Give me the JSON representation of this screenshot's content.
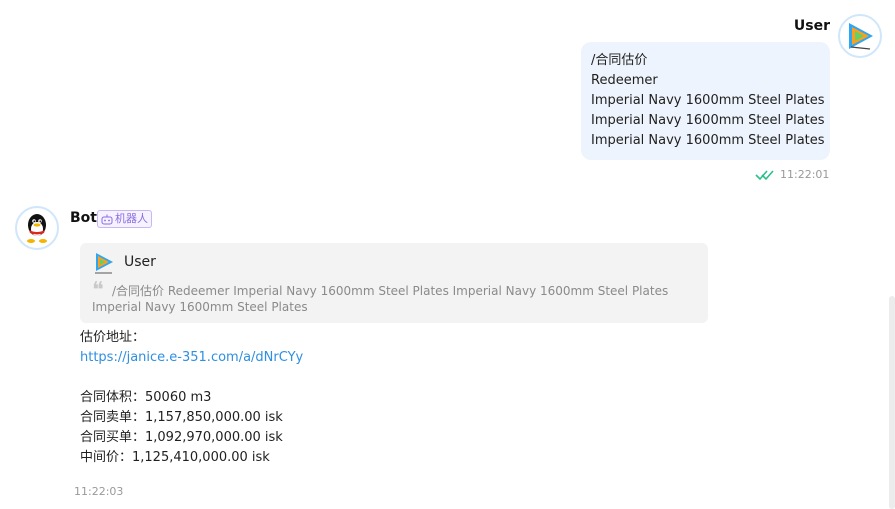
{
  "user_message": {
    "sender": "User",
    "lines": [
      "/合同估价",
      "Redeemer",
      "Imperial Navy 1600mm Steel Plates",
      "Imperial Navy 1600mm Steel Plates",
      "Imperial Navy 1600mm Steel Plates"
    ],
    "time": "11:22:01",
    "read_icon": "double-check-icon",
    "avatar_icon": "tencent-video-logo"
  },
  "bot_message": {
    "sender": "Bot",
    "tag": "机器人",
    "tag_icon": "robot-icon",
    "avatar_icon": "qq-penguin-logo",
    "quote": {
      "user": "User",
      "text": "/合同估价 Redeemer Imperial Navy 1600mm Steel Plates Imperial Navy 1600mm Steel Plates Imperial Navy 1600mm Steel Plates"
    },
    "address_label": "估价地址：",
    "link": "https://janice.e-351.com/a/dNrCYy",
    "volume": "合同体积：50060 m3",
    "sell": "合同卖单：1,157,850,000.00 isk",
    "buy": "合同买单：1,092,970,000.00 isk",
    "mid": "中间价：1,125,410,000.00 isk",
    "time": "11:22:03"
  },
  "colors": {
    "user_bubble": "#eef4fd",
    "link": "#2f8fe0",
    "read_check": "#2bbf8a",
    "tag": "#8a6ee0"
  }
}
